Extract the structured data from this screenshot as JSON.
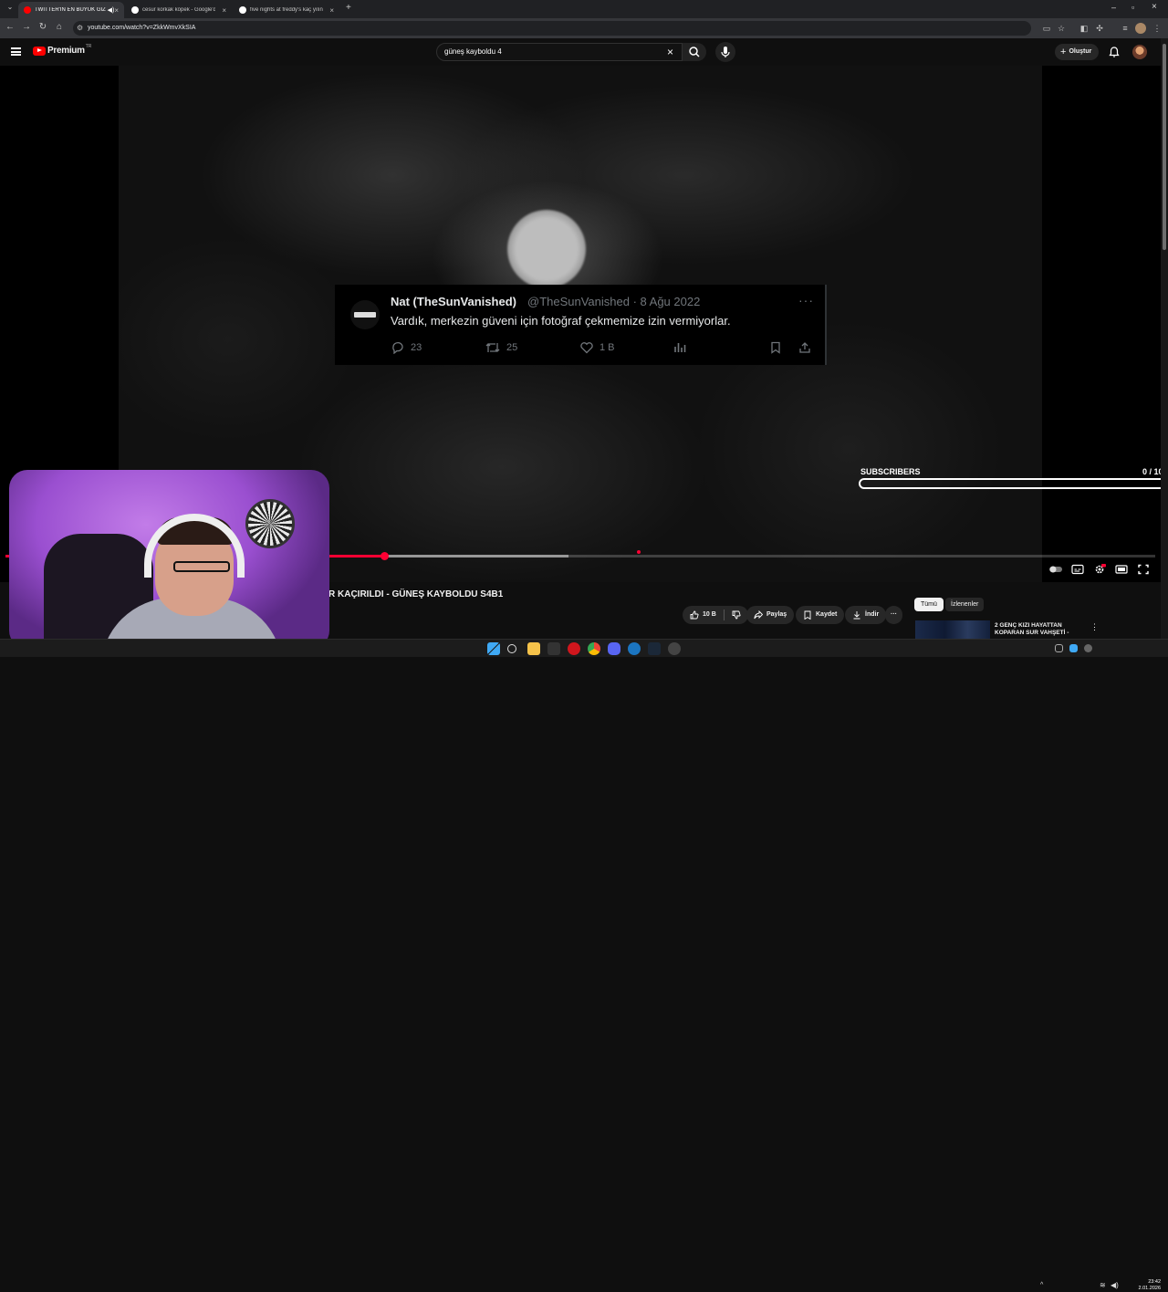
{
  "browser": {
    "tabs": [
      {
        "title": "TWITTER'IN EN BÜYÜK GİZ",
        "active": true
      },
      {
        "title": "cesur korkak köpek - Google'da",
        "active": false
      },
      {
        "title": "five nights at freddy's kaç yılında",
        "active": false
      }
    ],
    "new_tab": "+",
    "url": "youtube.com/watch?v=ZkkWmvXkSIA",
    "window_controls": [
      "–",
      "▫",
      "×"
    ]
  },
  "youtube": {
    "logo_text": "Premium",
    "logo_region": "TR",
    "search_value": "güneş kayboldu 4",
    "search_clear": "×",
    "create_label": "Oluştur",
    "create_plus": "+"
  },
  "tweet": {
    "name": "Nat (TheSunVanished)",
    "meta": "@TheSunVanished · 8 Ağu 2022",
    "text": "Vardık, merkezin güveni için fotoğraf çekmemize izin vermiyorlar.",
    "more": "···",
    "replies": "23",
    "retweets": "25",
    "likes": "1 B"
  },
  "overlay": {
    "subscribers_label": "SUBSCRIBERS",
    "subscribers_count": "0  / 10",
    "subscribers_progress": 0
  },
  "player": {
    "progress_fraction": 0.33,
    "buffered_fraction": 0.49
  },
  "video": {
    "title": "R KAÇIRILDI - GÜNEŞ KAYBOLDU S4B1",
    "like_count": "10 B",
    "share_label": "Paylaş",
    "save_label": "Kaydet",
    "download_label": "İndir",
    "more": "···"
  },
  "recommendations": {
    "chips": [
      "Tümü",
      "İzlenenler"
    ],
    "items": [
      {
        "title": "2 GENÇ KIZI HAYATTAN KOPARAN SUR VAHŞETİ -"
      }
    ],
    "more": "⋮"
  },
  "taskbar": {
    "time": "23:42",
    "date": "2.01.2026"
  },
  "colors": {
    "accent_red": "#ff0033",
    "background": "#0f0f0f",
    "webcam_purple": "#b26be0"
  }
}
